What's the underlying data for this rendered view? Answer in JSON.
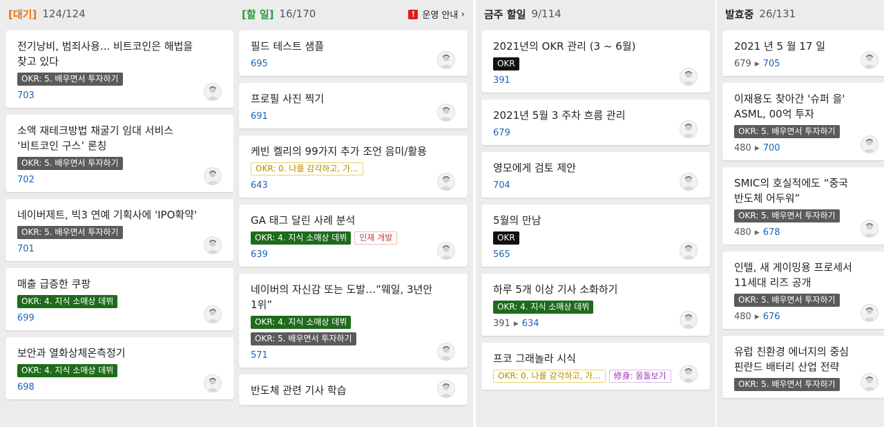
{
  "columns": [
    {
      "title": "[대기]",
      "count": "124/124",
      "cards": [
        {
          "title": "전기낭비, 범죄사용... 비트코인은 해법을 찾고 있다",
          "tags": [
            {
              "text": "OKR: 5. 배우면서 투자하기",
              "style": "gray"
            }
          ],
          "ids": [
            "703"
          ]
        },
        {
          "title": "소액 재테크방법 채굴기 임대 서비스 ‘비트코인 구스’ 론칭",
          "tags": [
            {
              "text": "OKR: 5. 배우면서 투자하기",
              "style": "gray"
            }
          ],
          "ids": [
            "702"
          ]
        },
        {
          "title": "네이버제트, 빅3 연예 기획사에 'IPO확약'",
          "tags": [
            {
              "text": "OKR: 5. 배우면서 투자하기",
              "style": "gray"
            }
          ],
          "ids": [
            "701"
          ]
        },
        {
          "title": "매출 급증한 쿠팡",
          "tags": [
            {
              "text": "OKR: 4. 지식 소매상 데뷔",
              "style": "green"
            }
          ],
          "ids": [
            "699"
          ]
        },
        {
          "title": "보안과 열화상체온측정기",
          "tags": [
            {
              "text": "OKR: 4. 지식 소매상 데뷔",
              "style": "green"
            }
          ],
          "ids": [
            "698"
          ]
        }
      ]
    },
    {
      "title": "[할 일]",
      "count": "16/170",
      "notice": "운영 안내",
      "cards": [
        {
          "title": "필드 테스트 샘플",
          "tags": [],
          "ids": [
            "695"
          ]
        },
        {
          "title": "프로필 사진 찍기",
          "tags": [],
          "ids": [
            "691"
          ]
        },
        {
          "title": "케빈 켈리의 99가지 추가 조언 음미/활용",
          "tags": [
            {
              "text": "OKR: 0. 나를 감각하고, 가...",
              "style": "yellow"
            }
          ],
          "ids": [
            "643"
          ]
        },
        {
          "title": "GA 태그 달린 사례 분석",
          "tags": [
            {
              "text": "OKR: 4. 지식 소매상 데뷔",
              "style": "green"
            },
            {
              "text": "인재 개발",
              "style": "red"
            }
          ],
          "ids": [
            "639"
          ]
        },
        {
          "title": "네이버의 자신감 또는 도발…”웨일, 3년안 1위”",
          "tags": [
            {
              "text": "OKR: 4. 지식 소매상 데뷔",
              "style": "green"
            },
            {
              "text": "OKR: 5. 배우면서 투자하기",
              "style": "gray"
            }
          ],
          "ids": [
            "571"
          ]
        },
        {
          "title": "반도체 관련 기사 학습",
          "tags": [],
          "ids": []
        }
      ]
    },
    {
      "title": "금주 할일",
      "count": "9/114",
      "cards": [
        {
          "title": "2021년의 OKR 관리 (3 ~ 6월)",
          "tags": [
            {
              "text": "OKR",
              "style": "black"
            }
          ],
          "ids": [
            "391"
          ]
        },
        {
          "title": "2021년 5월 3 주차 흐름 관리",
          "tags": [],
          "ids": [
            "679"
          ]
        },
        {
          "title": "영모에게 검토 제안",
          "tags": [],
          "ids": [
            "704"
          ]
        },
        {
          "title": "5월의 만남",
          "tags": [
            {
              "text": "OKR",
              "style": "black"
            }
          ],
          "ids": [
            "565"
          ]
        },
        {
          "title": "하루 5개 이상 기사 소화하기",
          "tags": [
            {
              "text": "OKR: 4. 지식 소매상 데뷔",
              "style": "green"
            }
          ],
          "ids": [
            "391",
            "634"
          ]
        },
        {
          "title": "프코 그래놀라 시식",
          "tags": [
            {
              "text": "OKR: 0. 나를 감각하고, 가...",
              "style": "yellow"
            },
            {
              "text": "修身: 몸돌보기",
              "style": "purple"
            }
          ],
          "ids": []
        }
      ]
    },
    {
      "title": "발효중",
      "count": "26/131",
      "cards": [
        {
          "title": "2021 년 5 월 17 일",
          "tags": [],
          "ids": [
            "679",
            "705"
          ]
        },
        {
          "title": "이재용도 찾아간 '슈퍼 을' ASML, 00억 투자",
          "tags": [
            {
              "text": "OKR: 5. 배우면서 투자하기",
              "style": "gray"
            }
          ],
          "ids": [
            "480",
            "700"
          ]
        },
        {
          "title": "SMIC의 호실적에도 “중국 반도체 어두워”",
          "tags": [
            {
              "text": "OKR: 5. 배우면서 투자하기",
              "style": "gray"
            }
          ],
          "ids": [
            "480",
            "678"
          ]
        },
        {
          "title": "인텔, 새 게이밍용 프로세서 11세대 리즈 공개",
          "tags": [
            {
              "text": "OKR: 5. 배우면서 투자하기",
              "style": "gray"
            }
          ],
          "ids": [
            "480",
            "676"
          ]
        },
        {
          "title": "유럽 친환경 에너지의 중심 핀란드 배터리 산업 전략",
          "tags": [
            {
              "text": "OKR: 5. 배우면서 투자하기",
              "style": "gray"
            }
          ],
          "ids": []
        }
      ]
    }
  ],
  "colors": {
    "title_orange": "#e6770c",
    "title_green": "#2a9a3a",
    "link_blue": "#1e62b7",
    "tag_green": "#1f6b1b",
    "tag_gray": "#5b5b5b"
  },
  "icons": {
    "notice": "warning-icon",
    "chevron": "chevron-right-icon",
    "avatar": "avatar-icon",
    "arrow": "triangle-right-icon"
  }
}
